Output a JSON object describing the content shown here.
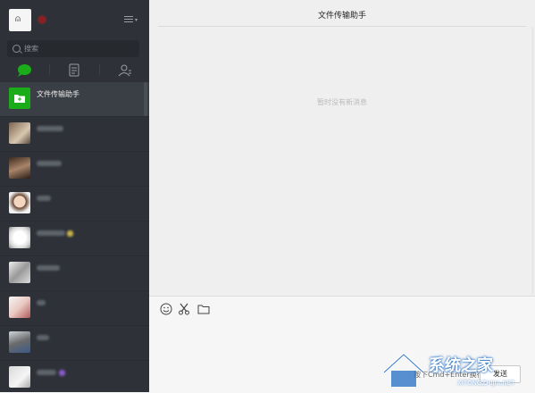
{
  "sidebar": {
    "search": {
      "placeholder": "搜索"
    },
    "tabs": [
      {
        "name": "chat",
        "icon": "chat-bubble-icon",
        "active": true
      },
      {
        "name": "articles",
        "icon": "article-icon",
        "active": false
      },
      {
        "name": "contacts",
        "icon": "contacts-icon",
        "active": false
      }
    ],
    "chats": [
      {
        "name": "文件传输助手",
        "active": true
      },
      {
        "name": ""
      },
      {
        "name": ""
      },
      {
        "name": ""
      },
      {
        "name": ""
      },
      {
        "name": ""
      },
      {
        "name": ""
      },
      {
        "name": ""
      },
      {
        "name": ""
      }
    ]
  },
  "main": {
    "title": "文件传输助手",
    "empty_hint": "暂时没有新消息",
    "composer": {
      "tools": [
        "emoji-icon",
        "scissors-icon",
        "folder-icon"
      ],
      "hint": "按下Cmd+Enter换行",
      "send_label": "发送"
    }
  },
  "watermark": {
    "text": "系统之家",
    "url": "XITONGZHIJIA.NET"
  },
  "colors": {
    "sidebar_bg": "#2e3238",
    "accent": "#1aad19",
    "main_bg": "#efefef"
  }
}
